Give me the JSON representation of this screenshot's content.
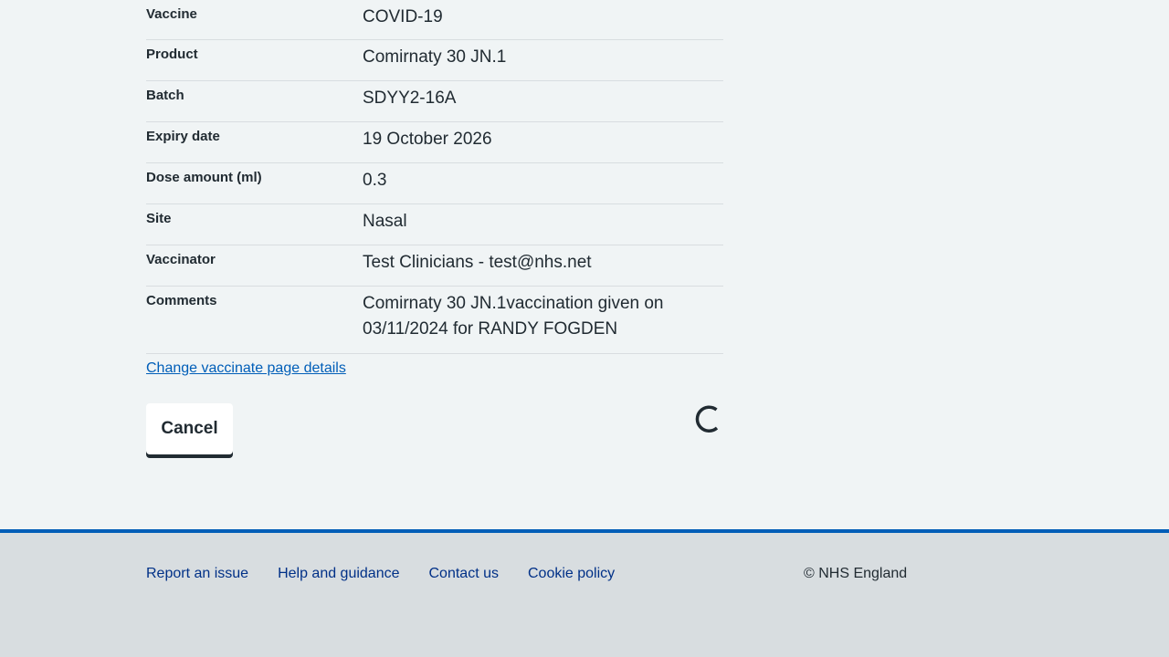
{
  "summary": {
    "rows": [
      {
        "key": "Vaccine",
        "value": "COVID-19"
      },
      {
        "key": "Product",
        "value": "Comirnaty 30 JN.1"
      },
      {
        "key": "Batch",
        "value": "SDYY2-16A"
      },
      {
        "key": "Expiry date",
        "value": "19 October 2026"
      },
      {
        "key": "Dose amount (ml)",
        "value": "0.3"
      },
      {
        "key": "Site",
        "value": "Nasal"
      },
      {
        "key": "Vaccinator",
        "value": "Test Clinicians - test@nhs.net"
      },
      {
        "key": "Comments",
        "value": "Comirnaty 30 JN.1vaccination given on 03/11/2024 for RANDY FOGDEN"
      }
    ]
  },
  "change_link": "Change vaccinate page details",
  "actions": {
    "cancel_label": "Cancel",
    "spinner_icon": "loading-spinner-icon"
  },
  "footer": {
    "links": [
      "Report an issue",
      "Help and guidance",
      "Contact us",
      "Cookie policy"
    ],
    "copyright": "© NHS England"
  },
  "colors": {
    "page_bg": "#f0f4f5",
    "text": "#212b32",
    "link": "#005eb8",
    "footer_link": "#003087",
    "footer_bg": "#d8dde0",
    "footer_border": "#005eb8"
  }
}
